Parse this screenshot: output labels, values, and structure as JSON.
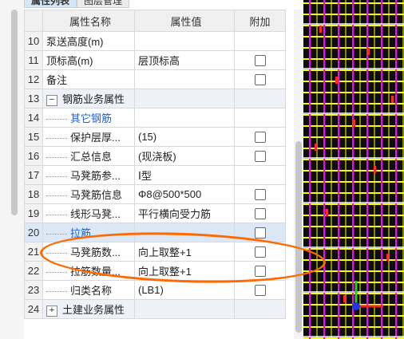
{
  "tabs": [
    "属性列表",
    "图层管理"
  ],
  "columns": {
    "name": "属性名称",
    "value": "属性值",
    "extra": "附加"
  },
  "rows": [
    {
      "num": "10",
      "name": "泵送高度(m)",
      "value": "",
      "check": false
    },
    {
      "num": "11",
      "name": "顶标高(m)",
      "value": "层顶标高",
      "check": true
    },
    {
      "num": "12",
      "name": "备注",
      "value": "",
      "check": true
    },
    {
      "num": "13",
      "name": "钢筋业务属性",
      "value": "",
      "check": false,
      "group": true,
      "toggle": "−"
    },
    {
      "num": "14",
      "name": "其它钢筋",
      "value": "",
      "check": false,
      "sub": true,
      "blue": true
    },
    {
      "num": "15",
      "name": "保护层厚...",
      "value": "(15)",
      "check": true,
      "sub": true
    },
    {
      "num": "16",
      "name": "汇总信息",
      "value": "(现浇板)",
      "check": true,
      "sub": true
    },
    {
      "num": "17",
      "name": "马凳筋参...",
      "value": "Ⅰ型",
      "check": false,
      "sub": true
    },
    {
      "num": "18",
      "name": "马凳筋信息",
      "value": "Φ8@500*500",
      "check": true,
      "sub": true
    },
    {
      "num": "19",
      "name": "线形马凳...",
      "value": "平行横向受力筋",
      "check": true,
      "sub": true
    },
    {
      "num": "20",
      "name": "拉筋",
      "value": "",
      "check": true,
      "sub": true,
      "blue": true,
      "selected": true
    },
    {
      "num": "21",
      "name": "马凳筋数...",
      "value": "向上取整+1",
      "check": true,
      "sub": true
    },
    {
      "num": "22",
      "name": "拉筋数量...",
      "value": "向上取整+1",
      "check": true,
      "sub": true
    },
    {
      "num": "23",
      "name": "归类名称",
      "value": "(LB1)",
      "check": true,
      "sub": true
    },
    {
      "num": "24",
      "name": "土建业务属性",
      "value": "",
      "check": false,
      "group": true,
      "toggle": "+"
    }
  ],
  "colors": {
    "canvas_bg": "#0d0d0d",
    "grid_yellow": "#ffff00",
    "grid_magenta": "#ff00ff",
    "annotation": "#ff6a00"
  }
}
